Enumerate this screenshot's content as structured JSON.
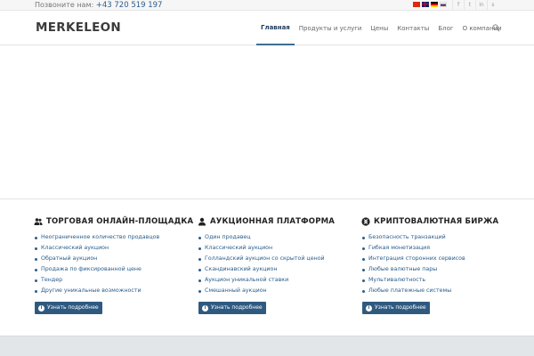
{
  "topbar": {
    "phone_label": "Позвоните нам:",
    "phone_number": "+43 720 519 197",
    "flags": [
      "china-flag-icon",
      "uk-flag-icon",
      "germany-flag-icon",
      "russia-flag-icon"
    ],
    "social": [
      {
        "icon": "facebook-icon",
        "glyph": "f"
      },
      {
        "icon": "twitter-icon",
        "glyph": "t"
      },
      {
        "icon": "linkedin-icon",
        "glyph": "in"
      },
      {
        "icon": "skype-icon",
        "glyph": "s"
      }
    ]
  },
  "header": {
    "logo_text": "MERKELEON",
    "nav": [
      "Главная",
      "Продукты и услуги",
      "Цены",
      "Контакты",
      "Блог",
      "О компании"
    ],
    "active_index": 0
  },
  "columns": [
    {
      "icon": "users-icon",
      "title": "ТОРГОВАЯ ОНЛАЙН-ПЛОЩАДКА",
      "items": [
        "Неограниченное количество продавцов",
        "Классический аукцион",
        "Обратный аукцион",
        "Продажа по фиксированной цене",
        "Тендер",
        "Другие уникальные возможности"
      ],
      "button": "Узнать подробнее"
    },
    {
      "icon": "user-icon",
      "title": "АУКЦИОННАЯ ПЛАТФОРМА",
      "items": [
        "Один продавец",
        "Классический аукцион",
        "Голландский аукцион со скрытой ценой",
        "Скандинавский аукцион",
        "Аукцион уникальной ставки",
        "Смешанный аукцион"
      ],
      "button": "Узнать подробнее"
    },
    {
      "icon": "bitcoin-icon",
      "title": "КРИПТОВАЛЮТНАЯ БИРЖА",
      "items": [
        "Безопасность транзакций",
        "Гибкая монетизация",
        "Интеграция сторонних сервисов",
        "Любые валютные пары",
        "Мультивалютность",
        "Любые платежные системы"
      ],
      "button": "Узнать подробнее"
    }
  ],
  "colors": {
    "accent": "#2f5a80",
    "link": "#2a5d8c",
    "footer_bg": "#e3e6e9"
  }
}
